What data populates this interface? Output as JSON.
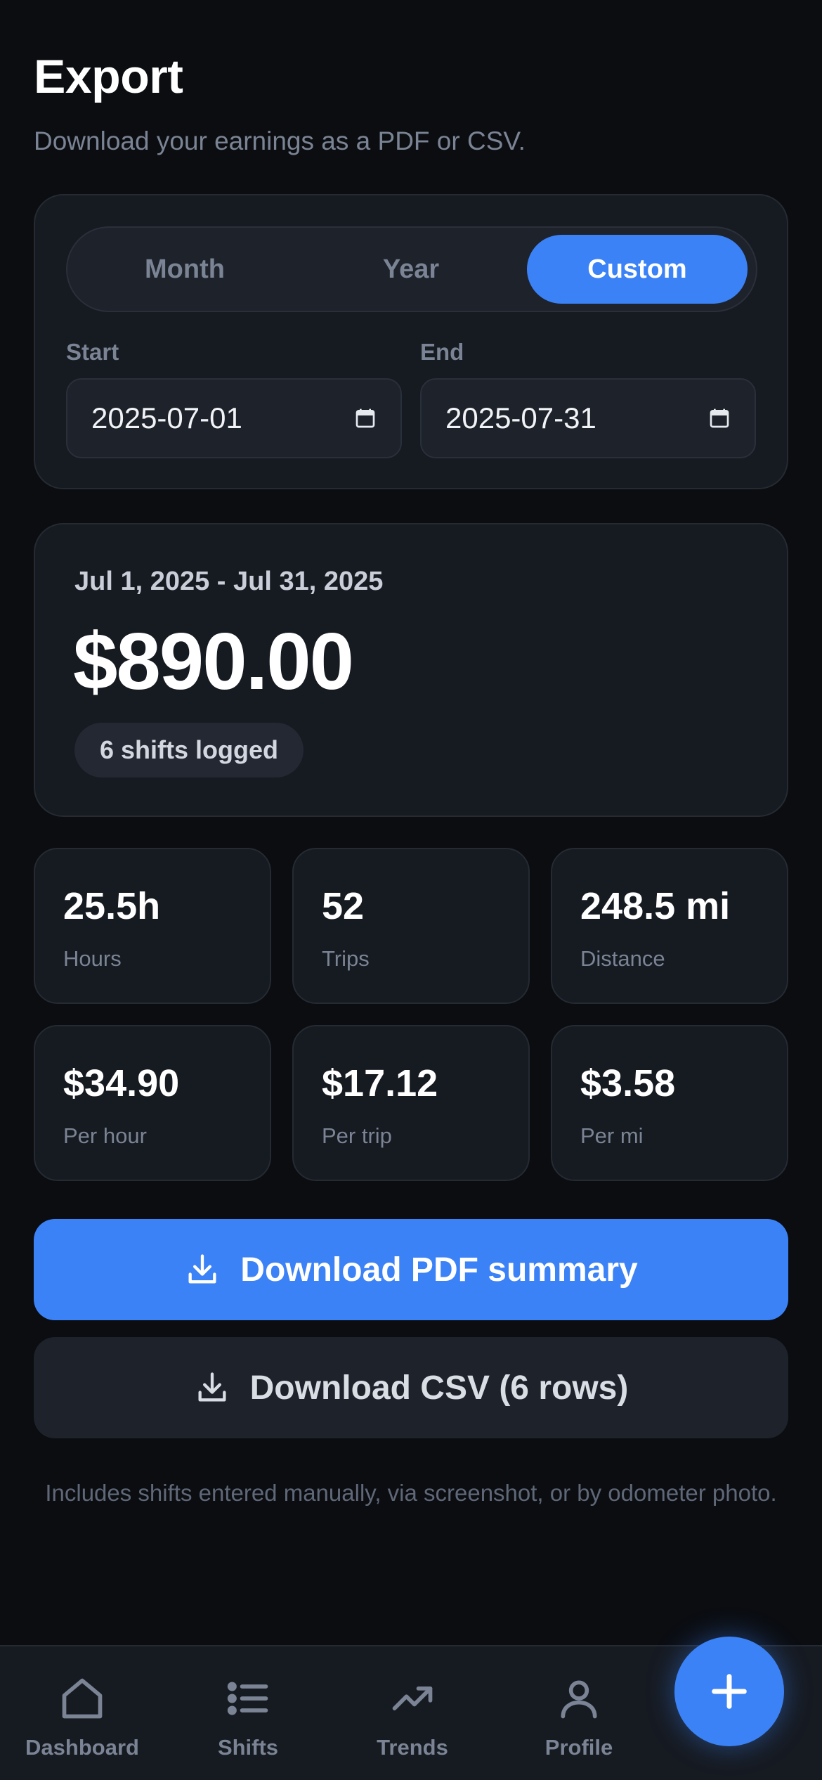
{
  "header": {
    "title": "Export",
    "subtitle": "Download your earnings as a PDF or CSV."
  },
  "range": {
    "options": [
      "Month",
      "Year",
      "Custom"
    ],
    "selected": "Custom",
    "start_label": "Start",
    "end_label": "End",
    "start_value": "2025-07-01",
    "end_value": "2025-07-31"
  },
  "summary": {
    "range_text": "Jul 1, 2025 - Jul 31, 2025",
    "total": "$890.00",
    "shifts_badge": "6 shifts logged"
  },
  "stats": [
    {
      "value": "25.5h",
      "label": "Hours"
    },
    {
      "value": "52",
      "label": "Trips"
    },
    {
      "value": "248.5 mi",
      "label": "Distance"
    },
    {
      "value": "$34.90",
      "label": "Per hour"
    },
    {
      "value": "$17.12",
      "label": "Per trip"
    },
    {
      "value": "$3.58",
      "label": "Per mi"
    }
  ],
  "actions": {
    "pdf_label": "Download PDF summary",
    "csv_label": "Download CSV (6 rows)"
  },
  "note": "Includes shifts entered manually, via screenshot, or by odometer photo.",
  "nav": {
    "items": [
      "Dashboard",
      "Shifts",
      "Trends",
      "Profile"
    ],
    "icons": [
      "home-icon",
      "list-icon",
      "trending-up-icon",
      "user-icon"
    ],
    "fab_icon": "plus-icon"
  },
  "colors": {
    "background": "#0b0d11",
    "card": "#161a21",
    "accent": "#3b82f6",
    "muted_text": "#7b8494"
  }
}
